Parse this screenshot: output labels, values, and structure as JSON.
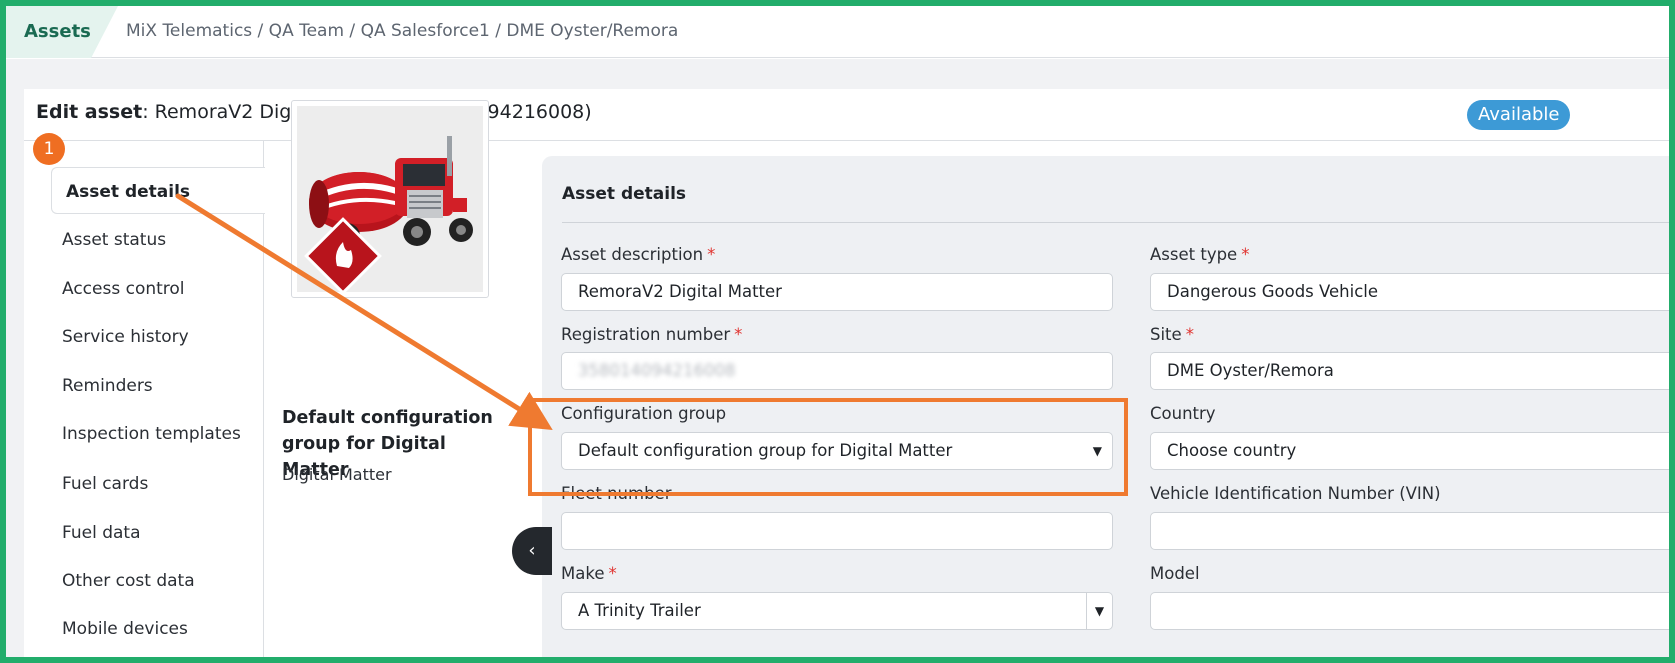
{
  "topbar": {
    "assets_tab": "Assets",
    "breadcrumb": "MiX Telematics / QA Team / QA Salesforce1 / DME Oyster/Remora"
  },
  "header": {
    "edit_label": "Edit asset",
    "asset_name": ": RemoraV2 Digital Matter (358014094216008)",
    "status": "Available"
  },
  "annotation": {
    "step": "1"
  },
  "nav": {
    "items": [
      "Asset details",
      "Asset status",
      "Access control",
      "Service history",
      "Reminders",
      "Inspection templates",
      "Fuel cards",
      "Fuel data",
      "Other cost data",
      "Mobile devices"
    ]
  },
  "asset_summary": {
    "config_group": "Default configuration group for Digital Matter",
    "device": "Digital Matter"
  },
  "form": {
    "title": "Asset details",
    "required_mark": "*",
    "asset_description": {
      "label": "Asset description",
      "value": "RemoraV2 Digital Matter"
    },
    "asset_type": {
      "label": "Asset type",
      "value": "Dangerous Goods Vehicle"
    },
    "registration_number": {
      "label": "Registration number",
      "value": "358014094216008"
    },
    "site": {
      "label": "Site",
      "value": "DME Oyster/Remora"
    },
    "configuration_group": {
      "label": "Configuration group",
      "value": "Default configuration group for Digital Matter"
    },
    "country": {
      "label": "Country",
      "value": "Choose country"
    },
    "fleet_number": {
      "label": "Fleet number",
      "value": ""
    },
    "vin": {
      "label": "Vehicle Identification Number (VIN)",
      "value": ""
    },
    "make": {
      "label": "Make",
      "value": "A Trinity Trailer"
    },
    "model": {
      "label": "Model",
      "value": ""
    }
  },
  "colors": {
    "frame": "#22ad6b",
    "accent_orange": "#ef7a30",
    "status_blue": "#3d9ad6",
    "required_red": "#e0332f"
  }
}
